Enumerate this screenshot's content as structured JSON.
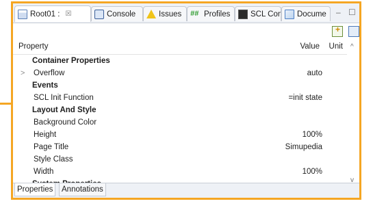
{
  "tabs": [
    {
      "label": "Root01 :",
      "close": "☒",
      "icon": "properties-icon"
    },
    {
      "label": "Console",
      "icon": "console-icon"
    },
    {
      "label": "Issues",
      "icon": "warning-icon"
    },
    {
      "label": "Profiles",
      "icon": "hash-icon",
      "glyph": "##"
    },
    {
      "label": "SCL Con",
      "icon": "terminal-icon"
    },
    {
      "label": "Docume",
      "icon": "document-icon"
    }
  ],
  "window_controls": {
    "minimize": "–",
    "maximize": "☐"
  },
  "columns": {
    "property": "Property",
    "value": "Value",
    "unit": "Unit"
  },
  "rows": [
    {
      "label": "Container Properties",
      "category": true,
      "value": ""
    },
    {
      "label": "Overflow",
      "category": false,
      "expandable": true,
      "value": "auto"
    },
    {
      "label": "Events",
      "category": true,
      "value": ""
    },
    {
      "label": "SCL Init Function",
      "category": false,
      "value": "=init state"
    },
    {
      "label": "Layout And Style",
      "category": true,
      "value": ""
    },
    {
      "label": "Background Color",
      "category": false,
      "value": ""
    },
    {
      "label": "Height",
      "category": false,
      "value": "100%"
    },
    {
      "label": "Page Title",
      "category": false,
      "value": "Simupedia"
    },
    {
      "label": "Style Class",
      "category": false,
      "value": ""
    },
    {
      "label": "Width",
      "category": false,
      "value": "100%"
    },
    {
      "label": "System Properties",
      "category": true,
      "value": ""
    }
  ],
  "bottom_tabs": [
    "Properties",
    "Annotations"
  ],
  "colors": {
    "frame": "#f5a623",
    "tabbar": "#eef1f6"
  }
}
